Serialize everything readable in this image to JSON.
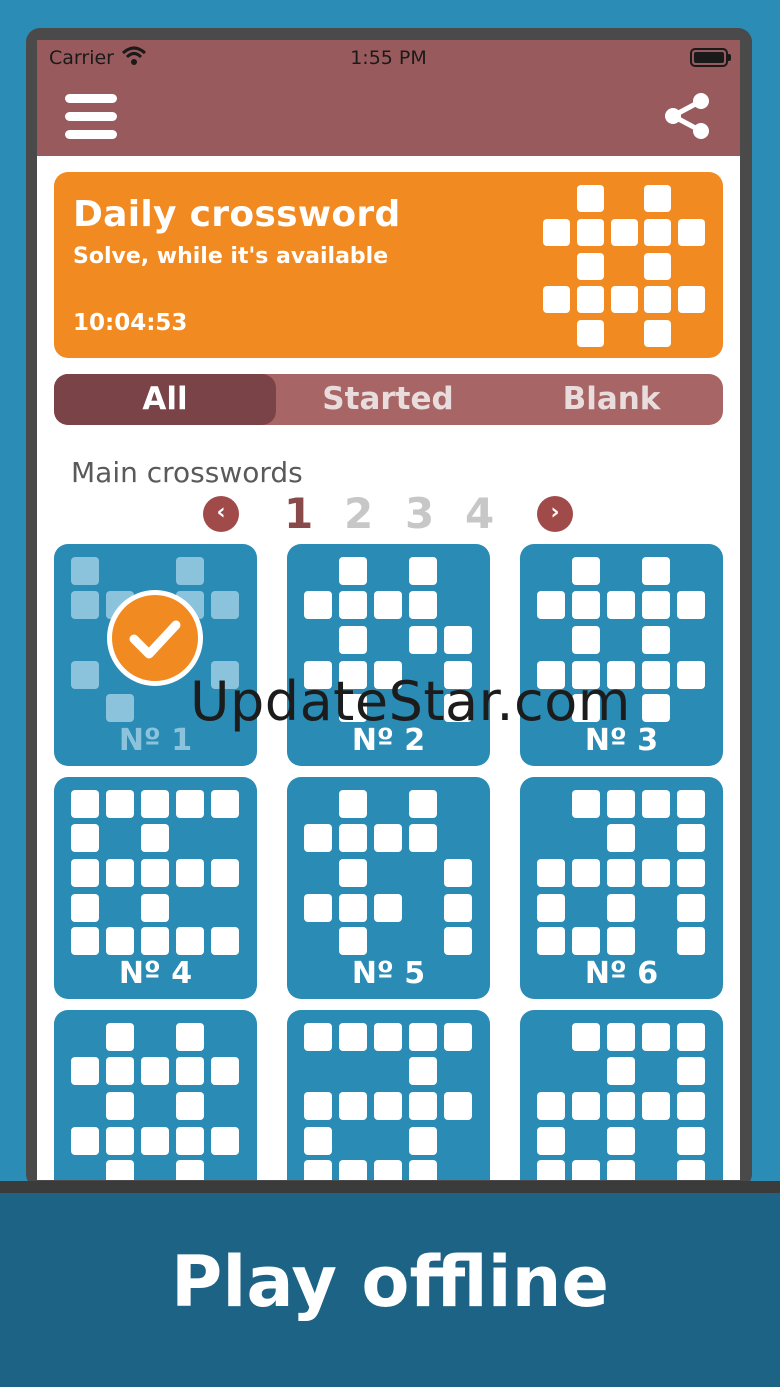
{
  "status_bar": {
    "carrier": "Carrier",
    "time": "1:55 PM"
  },
  "daily": {
    "title": "Daily crossword",
    "subtitle": "Solve, while it's available",
    "timer": "10:04:53"
  },
  "tabs": [
    "All",
    "Started",
    "Blank"
  ],
  "active_tab": "All",
  "section_title": "Main crosswords",
  "pages": [
    "1",
    "2",
    "3",
    "4"
  ],
  "current_page": "1",
  "puzzles": [
    {
      "label": "Nº 1",
      "completed": true
    },
    {
      "label": "Nº 2",
      "completed": false
    },
    {
      "label": "Nº 3",
      "completed": false
    },
    {
      "label": "Nº 4",
      "completed": false
    },
    {
      "label": "Nº 5",
      "completed": false
    },
    {
      "label": "Nº 6",
      "completed": false
    },
    {
      "label": "",
      "completed": false
    },
    {
      "label": "",
      "completed": false
    },
    {
      "label": "",
      "completed": false
    }
  ],
  "watermark": "UpdateStar.com",
  "banner": "Play offline",
  "colors": {
    "brand": "#985a5c",
    "accent": "#f28a22",
    "tile": "#2a8bb5",
    "background": "#2b8cb5"
  }
}
